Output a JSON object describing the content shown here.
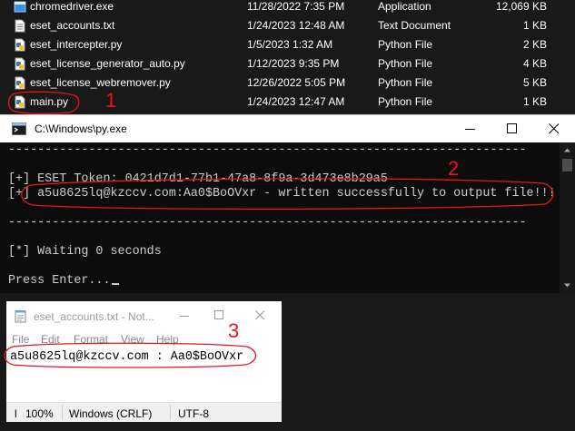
{
  "explorer": {
    "files": [
      {
        "name": "chromedriver.exe",
        "date": "11/28/2022 7:35 PM",
        "type": "Application",
        "size": "12,069 KB",
        "icon": "exe-icon"
      },
      {
        "name": "eset_accounts.txt",
        "date": "1/24/2023 12:48 AM",
        "type": "Text Document",
        "size": "1 KB",
        "icon": "txt-icon"
      },
      {
        "name": "eset_intercepter.py",
        "date": "1/5/2023 1:32 AM",
        "type": "Python File",
        "size": "2 KB",
        "icon": "python-icon"
      },
      {
        "name": "eset_license_generator_auto.py",
        "date": "1/12/2023 9:35 PM",
        "type": "Python File",
        "size": "4 KB",
        "icon": "python-icon"
      },
      {
        "name": "eset_license_webremover.py",
        "date": "12/26/2022 5:05 PM",
        "type": "Python File",
        "size": "5 KB",
        "icon": "python-icon"
      },
      {
        "name": "main.py",
        "date": "1/24/2023 12:47 AM",
        "type": "Python File",
        "size": "1 KB",
        "icon": "python-icon"
      }
    ]
  },
  "console": {
    "title": "C:\\Windows\\py.exe",
    "lines": [
      "-----------------------------------------------------------------------",
      "",
      "[+] ESET Token: 0421d7d1-77b1-47a8-8f9a-3d473e8b29a5",
      "[+] a5u8625lq@kzccv.com:Aa0$BoOVxr - written successfully to output file!!!",
      "",
      "-----------------------------------------------------------------------",
      "",
      "[*] Waiting 0 seconds",
      "",
      "Press Enter..."
    ]
  },
  "notepad": {
    "title": "eset_accounts.txt - Not...",
    "menu": [
      "File",
      "Edit",
      "Format",
      "View",
      "Help"
    ],
    "content": "a5u8625lq@kzccv.com : Aa0$BoOVxr",
    "status": {
      "position": "l",
      "zoom": "100%",
      "line_ending": "Windows (CRLF)",
      "encoding": "UTF-8"
    }
  },
  "annotations": {
    "labels": [
      "1",
      "2",
      "3"
    ],
    "color": "#e8141b"
  },
  "colors": {
    "console_bg": "#0c0c0c",
    "console_text": "#cccccc",
    "explorer_bg": "#191919"
  }
}
